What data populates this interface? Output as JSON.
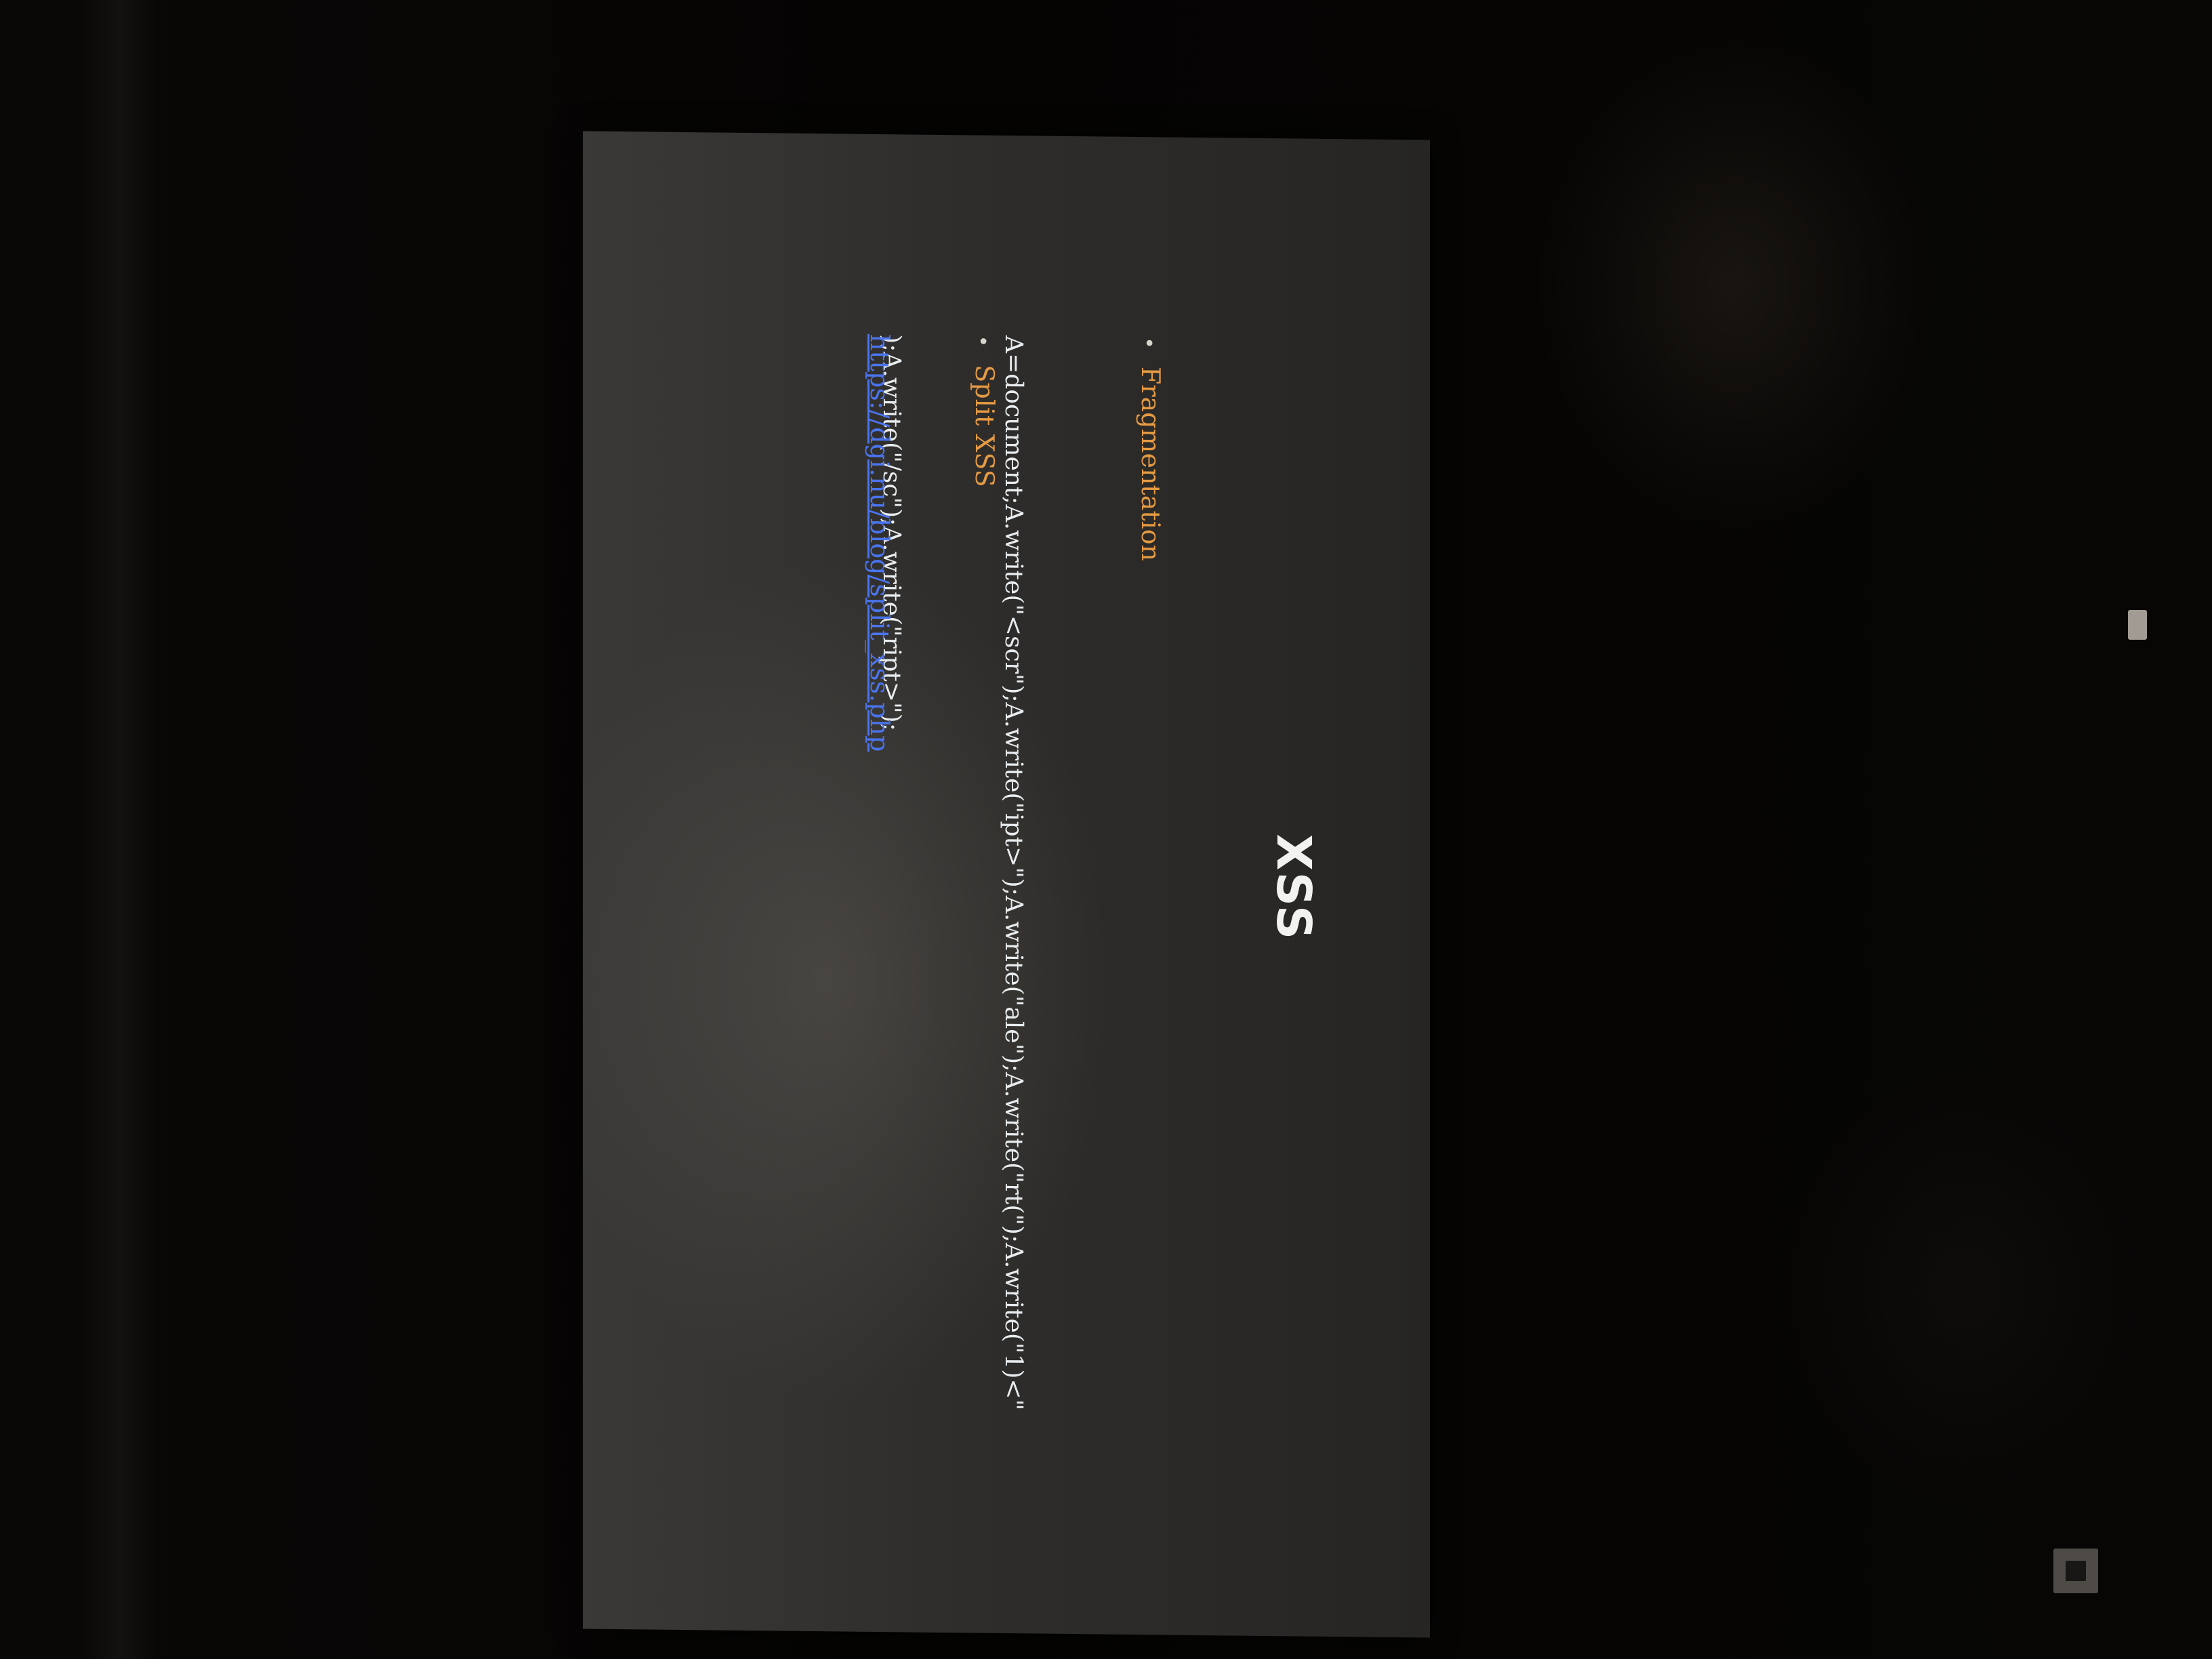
{
  "slide": {
    "title": "XSS",
    "bullets": [
      {
        "label": "Fragmentation"
      },
      {
        "label": "Split XSS"
      }
    ],
    "code_line_1": "A=document;A.write(\"<scr\");A.write(\"ipt>\");A.write(\"ale\");A.write(\"rt(\");A.write(\"1)<\"",
    "code_line_2": ");A.write(\"/sc\");A.write(\"ript>\");",
    "link_text": "https://dgi.nu/blog/split_xss.php"
  },
  "colors": {
    "bullet": "#e59a43",
    "code": "#e8ecee",
    "link": "#4a74ee",
    "slide_background": "#2f2d2b"
  }
}
